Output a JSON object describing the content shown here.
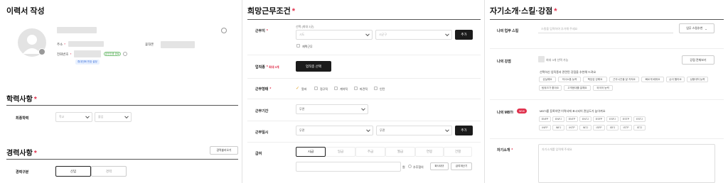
{
  "resume": {
    "title": "이력서 작성",
    "address_label": "주소",
    "phone_label": "전화번호",
    "mobile_label": "휴대폰",
    "verify_badge": "본인인증 완료",
    "checkbox_badge": "휴대전화 번호 설정",
    "education_title": "학력사항",
    "final_edu_label": "최종학력",
    "edu_select1": "학교",
    "edu_select2": "졸업",
    "career_title": "경력사항",
    "career_btn": "경력불러오기",
    "career_type_label": "경력구분",
    "career_new": "신입",
    "career_exp": "경력"
  },
  "conditions": {
    "title": "희망근무조건",
    "region_label": "근무지",
    "region_hint": "선택 (최대 3곳)",
    "region_select1": "시도",
    "region_select2": "시군구",
    "add_label": "추가",
    "remote_label": "재택근무",
    "job_label": "업직종",
    "job_hint": "최대 5개",
    "job_btn": "업직종 선택",
    "worktype_label": "근무형태",
    "worktypes": [
      "알바",
      "정규직",
      "계약직",
      "파견직",
      "인턴"
    ],
    "period_label": "근무기간",
    "period_value": "무관",
    "days_label": "근무일시",
    "days_select1": "무관",
    "days_select2": "무관",
    "pay_label": "급여",
    "pay_tabs": [
      "시급",
      "일급",
      "주급",
      "월급",
      "연봉",
      "건별"
    ],
    "pay_unit": "원",
    "pay_after": "추후협의",
    "pay_check1": "회사내규",
    "pay_check2": "급여계산기"
  },
  "intro": {
    "title": "자기소개·스킬·강점",
    "skill_label": "나의 업무 스킬",
    "skill_placeholder": "스킬을 입력하여 추가해 주세요",
    "skill_btn": "업무 스킬추천",
    "strength_label": "나의 강점",
    "strength_hint": "최대 3개 선택 가능",
    "strength_btn": "강점 전체보기",
    "strength_desc": "선택하신 업직종과 관련된 강점을 추천해 드려요",
    "strengths": [
      "성실해요",
      "의사소통 능력",
      "책임감 강해요",
      "근무시간을 잘 지켜요",
      "빠르게 배워요",
      "손이 빨라요",
      "상황대처 능력",
      "팀워크가 좋아요",
      "고객응대를 잘해요",
      "외국어 능력"
    ],
    "mbti_label": "나의 MBTI",
    "mbti_new": "NEW",
    "mbti_desc": "MBTI를 등록하면 이력서에 표시되어 관심도가 높아져요",
    "mbti_row1": [
      "ENFP",
      "ENFJ",
      "ENTP",
      "ENTJ",
      "ESFP",
      "ESFJ",
      "ESTP",
      "ESTJ"
    ],
    "mbti_row2": [
      "INFP",
      "INFJ",
      "INTP",
      "INTJ",
      "ISFP",
      "ISFJ",
      "ISTP",
      "ISTJ"
    ],
    "self_label": "자기소개",
    "self_placeholder": "자기소개를 입력해 주세요"
  }
}
